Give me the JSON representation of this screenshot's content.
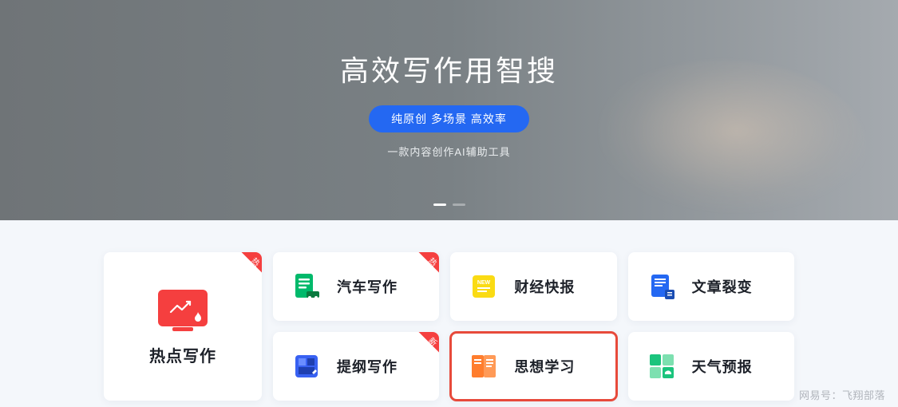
{
  "hero": {
    "title": "高效写作用智搜",
    "pill": "纯原创 多场景 高效率",
    "subtitle": "一款内容创作AI辅助工具"
  },
  "feature": {
    "title": "热点写作",
    "badge": "热"
  },
  "cards": [
    {
      "title": "汽车写作",
      "badge": "热",
      "icon": "car-doc-icon",
      "color": "#00b96b"
    },
    {
      "title": "财经快报",
      "badge": "",
      "icon": "finance-icon",
      "color": "#fadb14"
    },
    {
      "title": "文章裂变",
      "badge": "",
      "icon": "article-split-icon",
      "color": "#2468f2"
    },
    {
      "title": "提纲写作",
      "badge": "新",
      "icon": "outline-icon",
      "color": "#3861f2"
    },
    {
      "title": "思想学习",
      "badge": "",
      "icon": "study-icon",
      "color": "#ff7d2d",
      "highlight": true
    },
    {
      "title": "天气预报",
      "badge": "",
      "icon": "weather-icon",
      "color": "#1bc47d"
    }
  ],
  "watermark": "网易号：飞翔部落"
}
